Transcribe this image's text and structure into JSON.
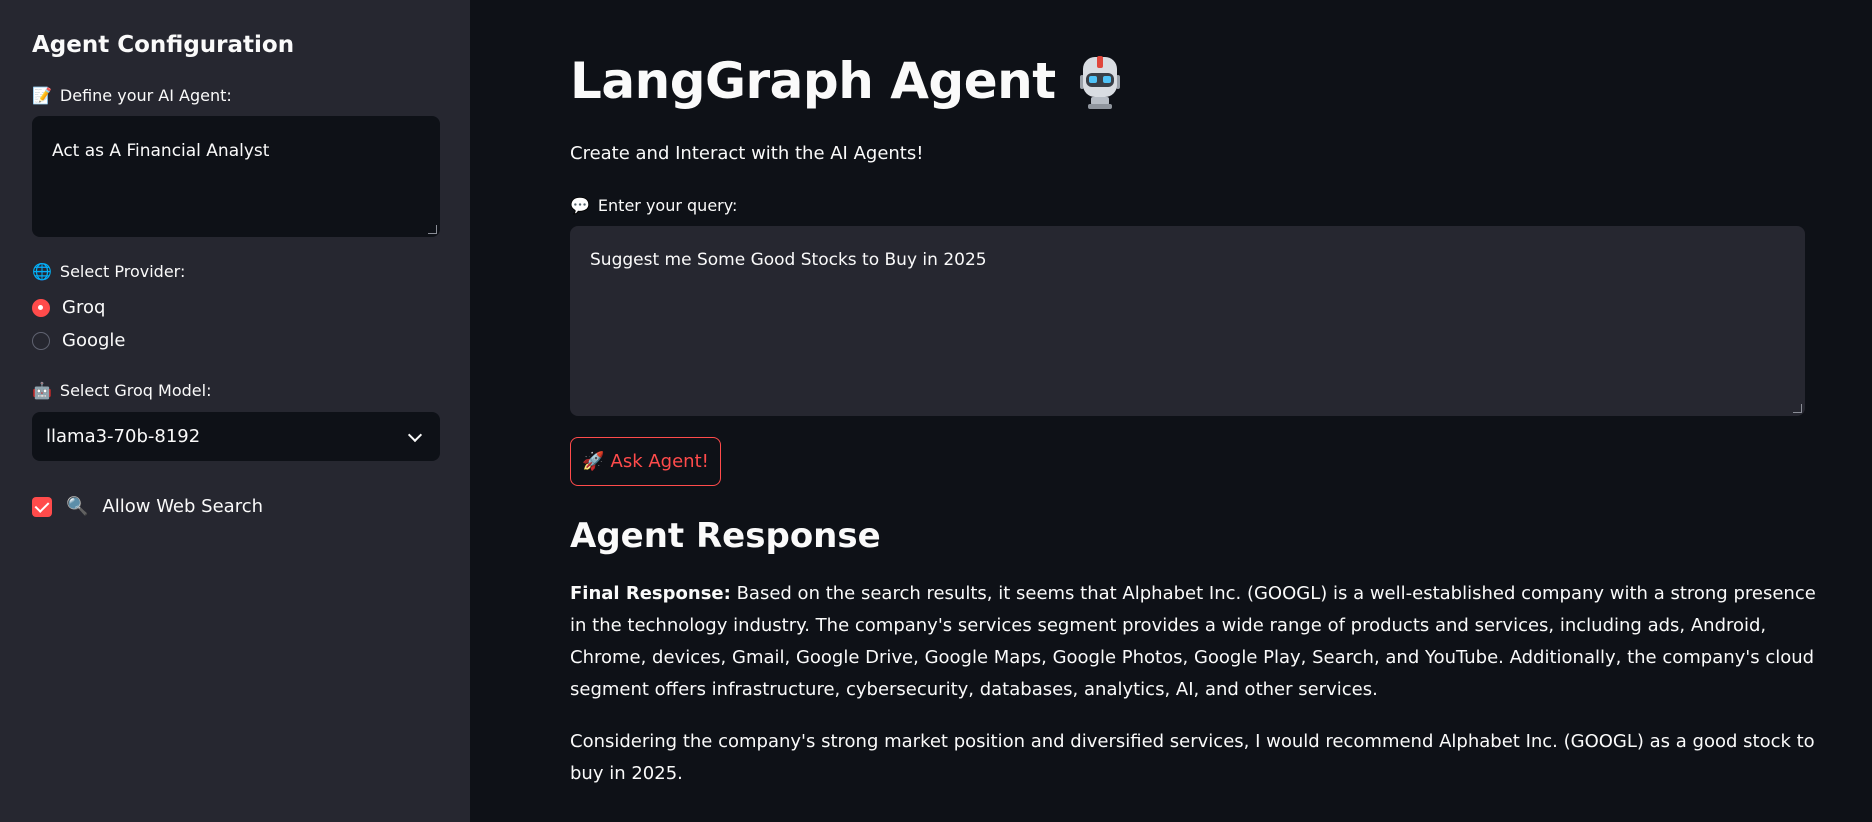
{
  "sidebar": {
    "title": "Agent Configuration",
    "define_label": "Define your AI Agent:",
    "define_icon": "memo-icon",
    "agent_definition": "Act as A Financial Analyst",
    "provider_label": "Select Provider:",
    "provider_icon": "globe-icon",
    "providers": [
      {
        "label": "Groq",
        "selected": true
      },
      {
        "label": "Google",
        "selected": false
      }
    ],
    "model_label": "Select Groq Model:",
    "model_icon": "robot-icon",
    "model_value": "llama3-70b-8192",
    "web_search_label": "Allow Web Search",
    "web_search_icon": "magnifier-icon",
    "web_search_checked": true
  },
  "main": {
    "title": "LangGraph Agent",
    "title_icon": "robot-icon",
    "subtitle": "Create and Interact with the AI Agents!",
    "query_label": "Enter your query:",
    "query_icon": "speech-bubble-icon",
    "query_value": "Suggest me Some Good Stocks to Buy in 2025",
    "ask_button_label": "Ask Agent!",
    "ask_button_icon": "rocket-icon",
    "response_heading": "Agent Response",
    "response_prefix": "Final Response:",
    "response_paragraph_1": "Based on the search results, it seems that Alphabet Inc. (GOOGL) is a well-established company with a strong presence in the technology industry. The company's services segment provides a wide range of products and services, including ads, Android, Chrome, devices, Gmail, Google Drive, Google Maps, Google Photos, Google Play, Search, and YouTube. Additionally, the company's cloud segment offers infrastructure, cybersecurity, databases, analytics, AI, and other services.",
    "response_paragraph_2": "Considering the company's strong market position and diversified services, I would recommend Alphabet Inc. (GOOGL) as a good stock to buy in 2025."
  },
  "colors": {
    "accent": "#ff4b4b",
    "sidebar_bg": "#262730",
    "main_bg": "#0e1117",
    "text": "#fafafa"
  }
}
